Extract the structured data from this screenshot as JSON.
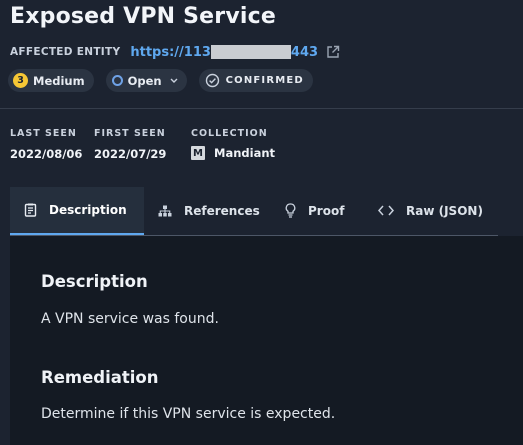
{
  "finding": {
    "title": "Exposed VPN Service",
    "entity_label": "AFFECTED ENTITY",
    "entity_url_start": "https://113",
    "entity_url_end": "443"
  },
  "badges": {
    "severity_number": "3",
    "severity_label": "Medium",
    "status_label": "Open",
    "confirmed_label": "CONFIRMED"
  },
  "meta": {
    "last_seen_label": "LAST SEEN",
    "last_seen_value": "2022/08/06",
    "first_seen_label": "FIRST SEEN",
    "first_seen_value": "2022/07/29",
    "collection_label": "COLLECTION",
    "collection_icon_letter": "M",
    "collection_value": "Mandiant"
  },
  "tabs": [
    {
      "label": "Description",
      "icon": "document-icon",
      "active": true
    },
    {
      "label": "References",
      "icon": "sitemap-icon",
      "active": false
    },
    {
      "label": "Proof",
      "icon": "bulb-icon",
      "active": false
    },
    {
      "label": "Raw (JSON)",
      "icon": "code-icon",
      "active": false
    }
  ],
  "content": {
    "description_heading": "Description",
    "description_text": "A VPN service was found.",
    "remediation_heading": "Remediation",
    "remediation_text": "Determine if this VPN service is expected."
  },
  "colors": {
    "background": "#1c2330",
    "panel": "#141a23",
    "accent": "#5fa8ef",
    "severity_medium": "#f6c735"
  }
}
